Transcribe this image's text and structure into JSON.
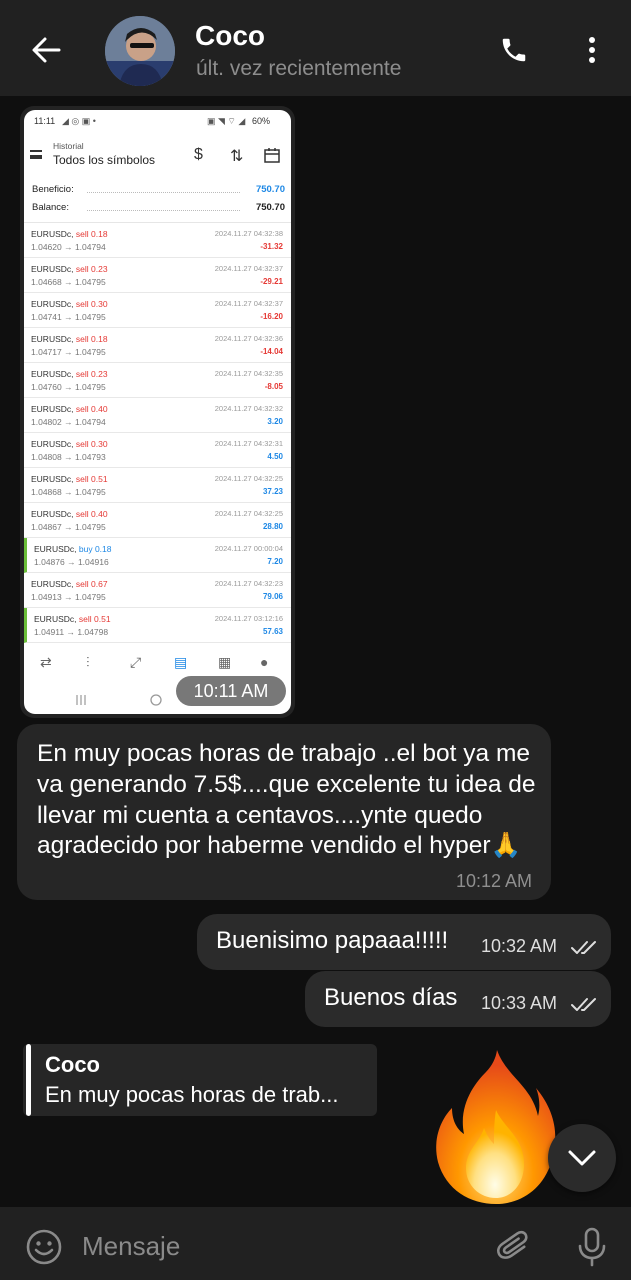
{
  "header": {
    "contact_name": "Coco",
    "status": "últ. vez recientemente"
  },
  "photo": {
    "status_bar": {
      "time": "11:11",
      "battery": "60%"
    },
    "app_header": {
      "subtitle": "Historial",
      "title": "Todos los símbolos"
    },
    "summary": [
      {
        "label": "Beneficio:",
        "value": "750.70"
      },
      {
        "label": "Balance:",
        "value": "750.70"
      }
    ],
    "trades": [
      {
        "symbol": "EURUSDc,",
        "type": "sell 0.18",
        "prices": "1.04620 → 1.04794",
        "time": "2024.11.27 04:32:38",
        "profit": "-31.32"
      },
      {
        "symbol": "EURUSDc,",
        "type": "sell 0.23",
        "prices": "1.04668 → 1.04795",
        "time": "2024.11.27 04:32:37",
        "profit": "-29.21"
      },
      {
        "symbol": "EURUSDc,",
        "type": "sell 0.30",
        "prices": "1.04741 → 1.04795",
        "time": "2024.11.27 04:32:37",
        "profit": "-16.20"
      },
      {
        "symbol": "EURUSDc,",
        "type": "sell 0.18",
        "prices": "1.04717 → 1.04795",
        "time": "2024.11.27 04:32:36",
        "profit": "-14.04"
      },
      {
        "symbol": "EURUSDc,",
        "type": "sell 0.23",
        "prices": "1.04760 → 1.04795",
        "time": "2024.11.27 04:32:35",
        "profit": "-8.05"
      },
      {
        "symbol": "EURUSDc,",
        "type": "sell 0.40",
        "prices": "1.04802 → 1.04794",
        "time": "2024.11.27 04:32:32",
        "profit": "3.20"
      },
      {
        "symbol": "EURUSDc,",
        "type": "sell 0.30",
        "prices": "1.04808 → 1.04793",
        "time": "2024.11.27 04:32:31",
        "profit": "4.50"
      },
      {
        "symbol": "EURUSDc,",
        "type": "sell 0.51",
        "prices": "1.04868 → 1.04795",
        "time": "2024.11.27 04:32:25",
        "profit": "37.23"
      },
      {
        "symbol": "EURUSDc,",
        "type": "sell 0.40",
        "prices": "1.04867 → 1.04795",
        "time": "2024.11.27 04:32:25",
        "profit": "28.80"
      },
      {
        "symbol": "EURUSDc,",
        "type": "buy 0.18",
        "prices": "1.04876 → 1.04916",
        "time": "2024.11.27 00:00:04",
        "profit": "7.20"
      },
      {
        "symbol": "EURUSDc,",
        "type": "sell 0.67",
        "prices": "1.04913 → 1.04795",
        "time": "2024.11.27 04:32:23",
        "profit": "79.06"
      },
      {
        "symbol": "EURUSDc,",
        "type": "sell 0.51",
        "prices": "1.04911 → 1.04798",
        "time": "2024.11.27 03:12:16",
        "profit": "57.63"
      }
    ],
    "timestamp": "10:11 AM"
  },
  "messages": {
    "incoming": {
      "text": "En muy pocas horas de trabajo ..el bot ya me va generando 7.5$....que excelente tu idea de llevar mi cuenta a centavos....ynte quedo agradecido por haberme vendido el hyper🙏",
      "time": "10:12 AM"
    },
    "outgoing": [
      {
        "text": "Buenisimo papaaa!!!!!",
        "time": "10:32 AM"
      },
      {
        "text": "Buenos días",
        "time": "10:33 AM"
      }
    ],
    "reply_preview": {
      "name": "Coco",
      "text": "En muy pocas horas de trab..."
    }
  },
  "composer": {
    "placeholder": "Mensaje"
  },
  "colors": {
    "background": "#0f0f0f",
    "header": "#212121",
    "bubble_in": "#262626",
    "bubble_out": "#2b2b2b",
    "loss": "#e53935",
    "gain": "#1e88e5",
    "buy": "#1e88e5"
  }
}
